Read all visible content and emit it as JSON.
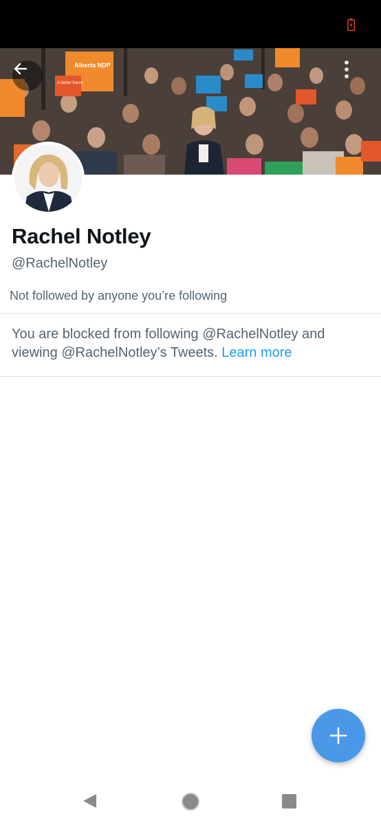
{
  "profile": {
    "display_name": "Rachel Notley",
    "handle": "@RachelNotley",
    "followers_note": "Not followed by anyone you’re following"
  },
  "blocked": {
    "message": "You are blocked from following @RachelNotley and viewing @RachelNotley’s Tweets.",
    "link_label": "Learn more"
  },
  "banner": {
    "signs": [
      "A better future.",
      "Alberta NDP",
      "Alberta NDP",
      "A better future for Alberta"
    ]
  },
  "icons": {
    "battery": "battery-charging-icon",
    "back": "arrow-left-icon",
    "more": "more-vertical-icon",
    "fab": "plus-icon",
    "nav_back": "triangle-back-icon",
    "nav_home": "circle-home-icon",
    "nav_recents": "square-recents-icon"
  },
  "colors": {
    "accent": "#1d9bf0",
    "fab": "#4a99e9",
    "text_primary": "#0f1419",
    "text_secondary": "#536471",
    "battery": "#e0402a"
  }
}
